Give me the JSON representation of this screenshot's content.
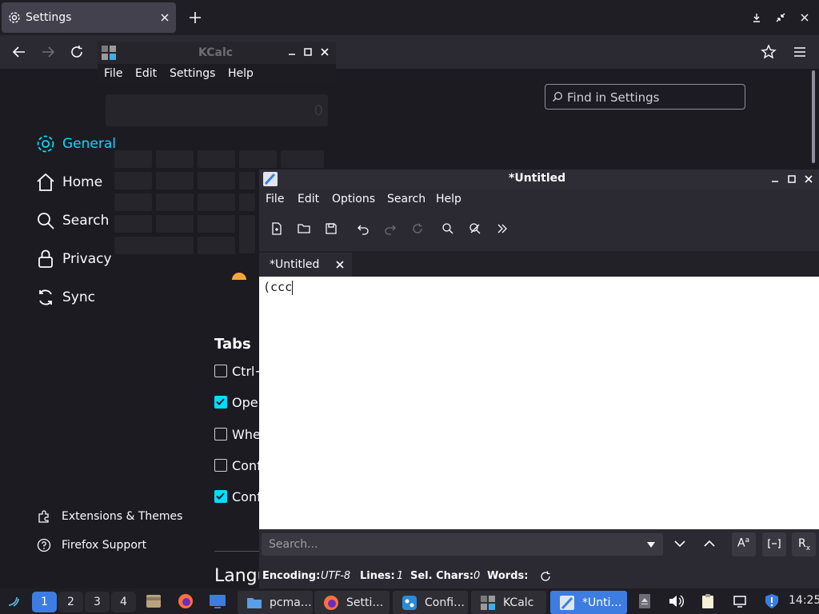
{
  "firefox": {
    "tab_title": "Settings",
    "find_placeholder": "Find in Settings",
    "nav": [
      "General",
      "Home",
      "Search",
      "Privacy",
      "Sync"
    ],
    "bottom_links": [
      "Extensions & Themes",
      "Firefox Support"
    ],
    "section_tabs": "Tabs",
    "checkboxes": [
      {
        "label": "Ctrl+",
        "checked": false
      },
      {
        "label": "Oper",
        "checked": true
      },
      {
        "label": "Whe",
        "checked": false
      },
      {
        "label": "Conf",
        "checked": false
      },
      {
        "label": "Conf",
        "checked": true
      }
    ],
    "section_language": "Langu"
  },
  "kcalc": {
    "title": "KCalc",
    "menu": [
      "File",
      "Edit",
      "Settings",
      "Help"
    ],
    "display": "0"
  },
  "editor": {
    "title": "*Untitled",
    "menu": [
      "File",
      "Edit",
      "Options",
      "Search",
      "Help"
    ],
    "tab_label": "*Untitled",
    "content": "(ccc",
    "search_placeholder": "Search...",
    "status": {
      "encoding_label": "Encoding:",
      "encoding": "UTF-8",
      "lines_label": "Lines:",
      "lines": "1",
      "sel_label": "Sel. Chars:",
      "sel": "0",
      "words_label": "Words:"
    }
  },
  "taskbar": {
    "workspaces": [
      "1",
      "2",
      "3",
      "4"
    ],
    "tasks": [
      "pcma…",
      "Setti…",
      "Confi…",
      "KCalc",
      "*Unti…"
    ],
    "clock": "14:25"
  },
  "colors": {
    "accent": "#00ddff",
    "taskbar_active": "#3d7de2"
  }
}
